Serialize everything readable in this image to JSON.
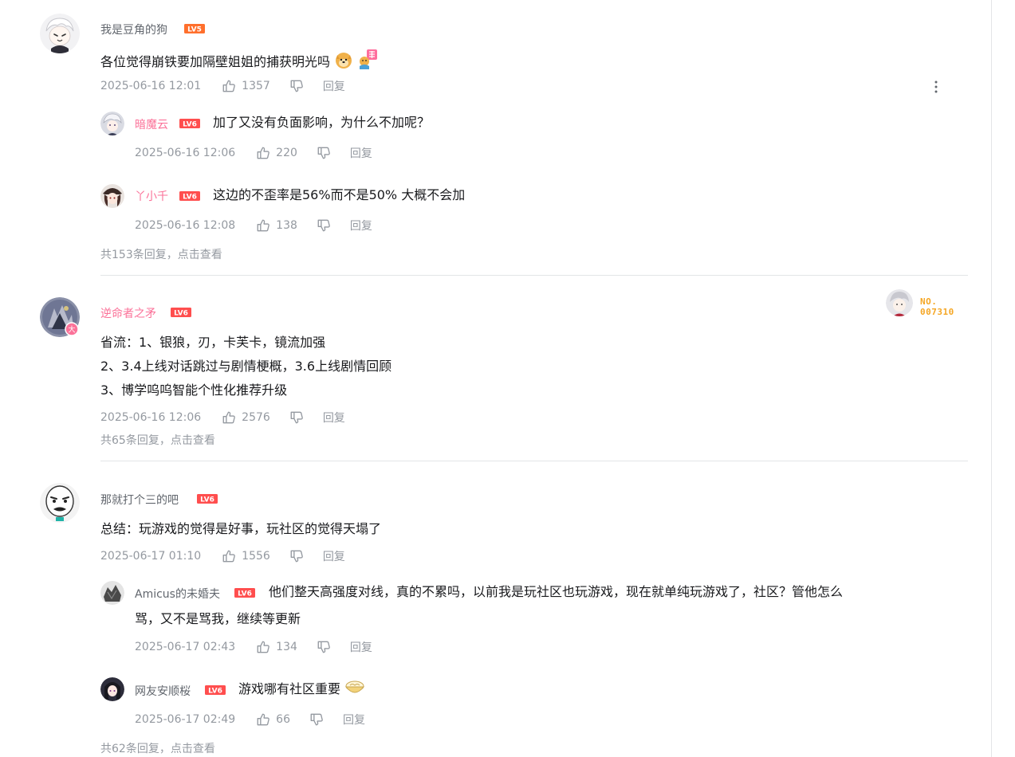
{
  "comments": [
    {
      "user": "我是豆角的狗",
      "level": "LV5",
      "content": "各位觉得崩铁要加隔壁姐姐的捕获明光吗",
      "time": "2025-06-16 12:01",
      "likes": "1357",
      "reply_label": "回复",
      "replies": [
        {
          "user": "暗魔云",
          "level": "LV6",
          "content": "加了又没有负面影响，为什么不加呢？",
          "time": "2025-06-16 12:06",
          "likes": "220",
          "reply_label": "回复"
        },
        {
          "user": "丫小千",
          "level": "LV6",
          "content": "这边的不歪率是56%而不是50% 大概不会加",
          "time": "2025-06-16 12:08",
          "likes": "138",
          "reply_label": "回复"
        }
      ],
      "more_replies": "共153条回复，点击查看"
    },
    {
      "user": "逆命者之矛",
      "level": "LV6",
      "content_lines": [
        "省流：1、银狼，刃，卡芙卡，镜流加强",
        "2、3.4上线对话跳过与剧情梗概，3.6上线剧情回顾",
        "3、博学呜呜智能个性化推荐升级"
      ],
      "time": "2025-06-16 12:06",
      "likes": "2576",
      "reply_label": "回复",
      "fan_badge": {
        "line1": "NO.",
        "line2": "007310"
      },
      "more_replies": "共65条回复，点击查看"
    },
    {
      "user": "那就打个三的吧",
      "level": "LV6",
      "content": "总结：玩游戏的觉得是好事，玩社区的觉得天塌了",
      "time": "2025-06-17 01:10",
      "likes": "1556",
      "reply_label": "回复",
      "replies": [
        {
          "user": "Amicus的未婚夫",
          "level": "LV6",
          "content_lines": [
            "他们整天高强度对线，真的不累吗，以前我是玩社区也玩游戏，现在就单纯玩游戏了，社区？管他怎么",
            "骂，又不是骂我，继续等更新"
          ],
          "time": "2025-06-17 02:43",
          "likes": "134",
          "reply_label": "回复"
        },
        {
          "user": "网友安顺桜",
          "level": "LV6",
          "content": "游戏哪有社区重要",
          "time": "2025-06-17 02:49",
          "likes": "66",
          "reply_label": "回复"
        }
      ],
      "more_replies": "共62条回复，点击查看"
    }
  ],
  "icons": {
    "like": "thumb-up-icon",
    "dislike": "thumb-down-icon",
    "more": "more-vertical-icon"
  },
  "colors": {
    "level_orange": "#ff6f2c",
    "level_red": "#ff4e4e",
    "vip_pink": "#fb7299",
    "meta_gray": "#9499a0",
    "fan_badge_gold": "#f5a623"
  }
}
